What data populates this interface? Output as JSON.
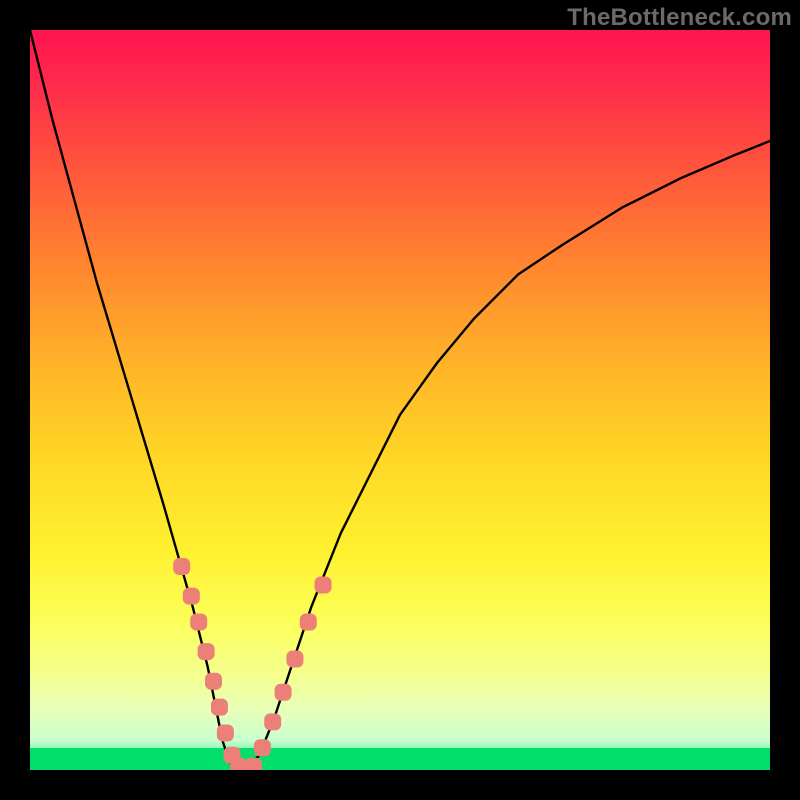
{
  "branding": {
    "watermark": "TheBottleneck.com"
  },
  "chart_data": {
    "type": "line",
    "title": "",
    "xlabel": "",
    "ylabel": "",
    "xlim": [
      0,
      100
    ],
    "ylim": [
      0,
      100
    ],
    "legend": false,
    "grid": false,
    "series": [
      {
        "name": "curve",
        "color": "#000000",
        "x": [
          0,
          3,
          6,
          9,
          12,
          15,
          18,
          20,
          22,
          24,
          25,
          26,
          27,
          28,
          29,
          31,
          33,
          35,
          38,
          42,
          46,
          50,
          55,
          60,
          66,
          72,
          80,
          88,
          95,
          100
        ],
        "y": [
          100,
          88,
          77,
          66,
          56,
          46,
          36,
          29,
          22,
          14,
          9,
          4,
          1,
          0,
          0,
          2,
          7,
          13,
          22,
          32,
          40,
          48,
          55,
          61,
          67,
          71,
          76,
          80,
          83,
          85
        ]
      }
    ],
    "markers": [
      {
        "name": "dots-left",
        "color": "#ec8079",
        "shape": "rounded",
        "x": [
          20.5,
          21.8,
          22.8,
          23.8,
          24.8,
          25.6,
          26.4,
          27.3,
          28.2,
          29.2
        ],
        "y": [
          27.5,
          23.5,
          20.0,
          16.0,
          12.0,
          8.5,
          5.0,
          2.0,
          0.5,
          0.0
        ]
      },
      {
        "name": "dots-right",
        "color": "#ec8079",
        "shape": "rounded",
        "x": [
          30.2,
          31.4,
          32.8,
          34.2,
          35.8,
          37.6,
          39.6
        ],
        "y": [
          0.5,
          3.0,
          6.5,
          10.5,
          15.0,
          20.0,
          25.0
        ]
      }
    ],
    "background": {
      "type": "vertical-gradient",
      "stops": [
        {
          "pos": 0.0,
          "color": "#ff1451"
        },
        {
          "pos": 0.2,
          "color": "#ff5a3a"
        },
        {
          "pos": 0.46,
          "color": "#ffd726"
        },
        {
          "pos": 0.8,
          "color": "#fcff5a"
        },
        {
          "pos": 1.0,
          "color": "#00e06b"
        }
      ]
    }
  }
}
